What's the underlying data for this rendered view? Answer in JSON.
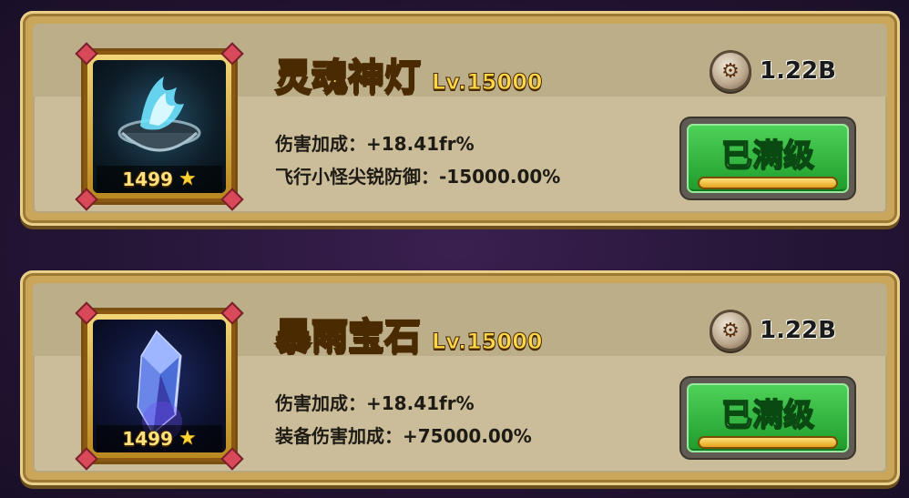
{
  "items": [
    {
      "name": "灵魂神灯",
      "level": "Lv.15000",
      "rating": "1499",
      "cost": "1.22B",
      "button_label": "已满级",
      "stats": [
        {
          "label": "伤害加成：",
          "value": "+18.41fr%"
        },
        {
          "label": "飞行小怪尖锐防御：",
          "value": "-15000.00%"
        }
      ],
      "icon": "soul-lamp-icon"
    },
    {
      "name": "暴雨宝石",
      "level": "Lv.15000",
      "rating": "1499",
      "cost": "1.22B",
      "button_label": "已满级",
      "stats": [
        {
          "label": "伤害加成：",
          "value": "+18.41fr%"
        },
        {
          "label": "装备伤害加成：",
          "value": "+75000.00%"
        }
      ],
      "icon": "storm-gem-icon"
    }
  ],
  "colors": {
    "title": "#ffd84a",
    "button_green": "#2fbf3c",
    "card_bg": "#cbbd9a"
  }
}
